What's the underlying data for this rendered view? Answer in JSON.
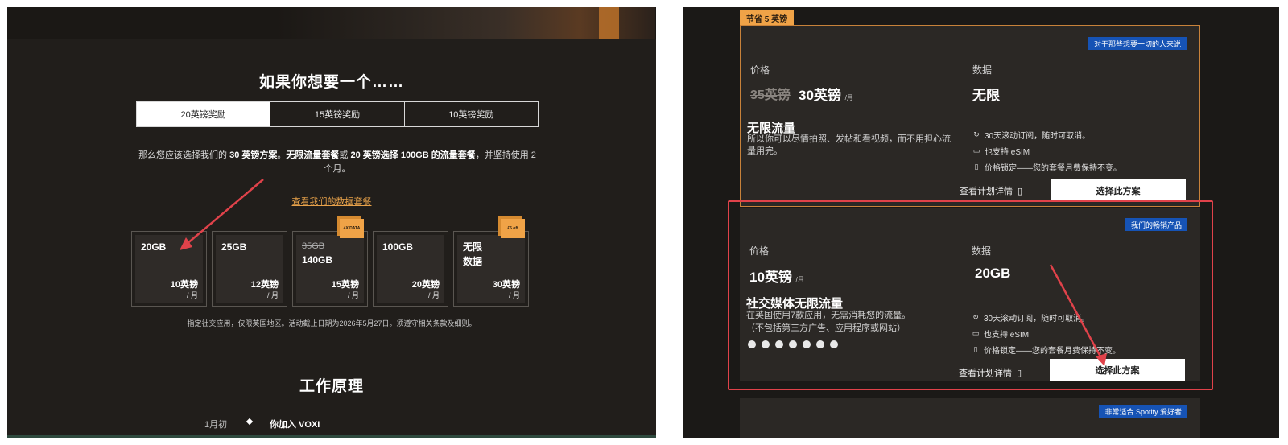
{
  "left": {
    "title": "如果你想要一个……",
    "tabs": [
      "20英镑奖励",
      "15英镑奖励",
      "10英镑奖励"
    ],
    "desc_parts": {
      "p1": "那么您应该选择我们的 ",
      "b1": "30 英镑方案",
      "p2": "。",
      "b2": "无限流量套餐",
      "p3": "或 ",
      "b3": "20 英镑选择 100GB 的流量套餐",
      "p4": "，并坚持使用 2 个月。"
    },
    "data_link": "查看我们的数据套餐",
    "cards": [
      {
        "gb": "20GB",
        "price": "10英镑",
        "per": "/ 月"
      },
      {
        "gb": "25GB",
        "price": "12英镑",
        "per": "/ 月"
      },
      {
        "gb_old": "35GB",
        "gb": "140GB",
        "price": "15英镑",
        "per": "/ 月",
        "sticker": "4X DATA"
      },
      {
        "gb": "100GB",
        "price": "20英镑",
        "per": "/ 月"
      },
      {
        "gb": "无限",
        "gb2": "数据",
        "price": "30英镑",
        "per": "/ 月",
        "sticker": "£5 off"
      }
    ],
    "terms": "指定社交应用，仅限英国地区。活动截止日期为2026年5月27日。须遵守相关条款及细则。",
    "how_title": "工作原理",
    "step": {
      "date": "1月初",
      "text": "你加入 VOXI"
    }
  },
  "right": {
    "save_tag": "节省 5 英镑",
    "plan1": {
      "badge": "对于那些想要一切的人来说",
      "price_label": "价格",
      "old_price": "35英镑",
      "price": "30英镑",
      "unit": "/月",
      "data_label": "数据",
      "data": "无限",
      "headline": "无限流量",
      "sub": "所以你可以尽情拍照、发帖和看视频，而不用担心流量用完。",
      "features": [
        "30天滚动订阅，随时可取消。",
        "也支持 eSIM",
        "价格锁定——您的套餐月费保持不变。"
      ],
      "details": "查看计划详情",
      "choose": "选择此方案"
    },
    "plan2": {
      "badge": "我们的畅销产品",
      "price_label": "价格",
      "price": "10英镑",
      "unit": "/月",
      "data_label": "数据",
      "data": "20GB",
      "headline": "社交媒体无限流量",
      "sub1": "在英国使用7款应用，无需消耗您的流量。",
      "sub2": "（不包括第三方广告、应用程序或网站）",
      "features": [
        "30天滚动订阅，随时可取消。",
        "也支持 eSIM",
        "价格锁定——您的套餐月费保持不变。"
      ],
      "details": "查看计划详情",
      "choose": "选择此方案"
    },
    "plan3": {
      "badge": "非常适合 Spotify 爱好者"
    }
  },
  "colors": {
    "accent_orange": "#f0a347",
    "badge_blue": "#1653b5",
    "annotation_red": "#e0424a"
  }
}
